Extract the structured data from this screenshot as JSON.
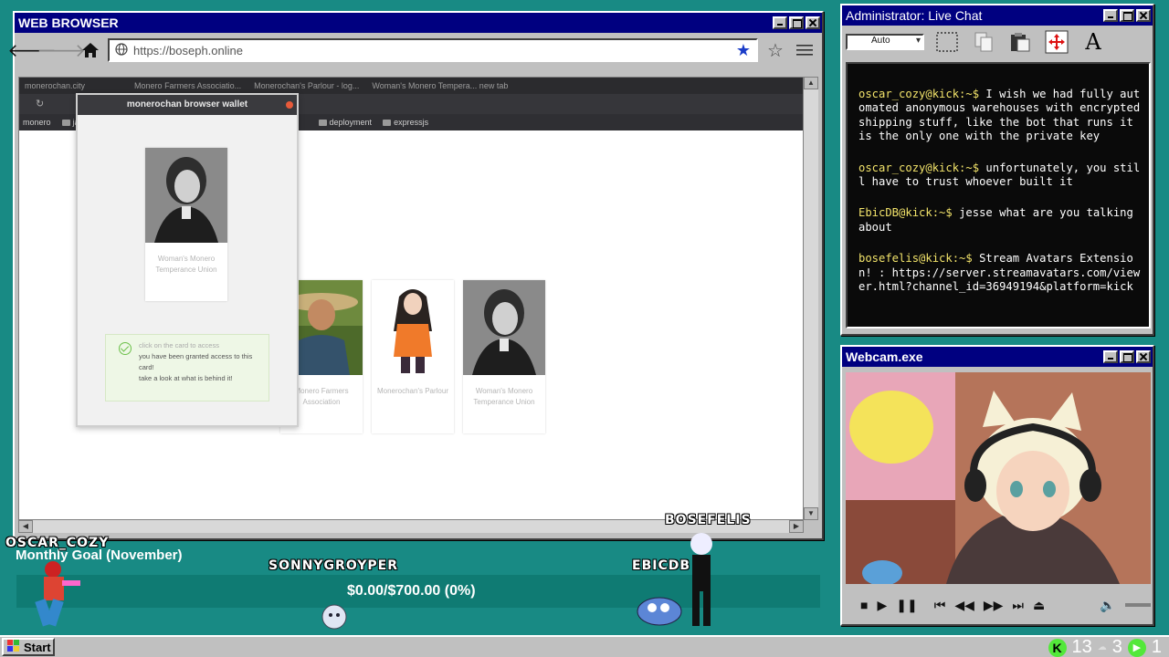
{
  "browser": {
    "title": "WEB BROWSER",
    "url": "https://boseph.online",
    "inner_tabs": [
      "monerochan.city",
      "Monero Farmers Associatio...",
      "Monerochan's Parlour - log...",
      "Woman's Monero Tempera... new tab"
    ],
    "bookmarks": [
      "monero",
      "ja",
      "deployment",
      "expressjs"
    ],
    "wallet": {
      "header": "monerochan browser wallet",
      "card_caption": "Woman's Monero Temperance Union",
      "notice_line1": "click on the card to access",
      "notice_line2": "you have been granted access to this card!",
      "notice_line3": "take a look at what is behind it!"
    },
    "cards": [
      {
        "caption": "Monero Farmers Association"
      },
      {
        "caption": "Monerochan's Parlour"
      },
      {
        "caption": "Woman's Monero Temperance Union"
      }
    ]
  },
  "chat": {
    "title": "Administrator: Live Chat",
    "font_size": "Auto",
    "messages": [
      {
        "user": "oscar_cozy@kick:~$",
        "text": "I wish we had fully automated anonymous warehouses with encrypted shipping stuff, like the bot that runs it is the only one with the private key"
      },
      {
        "user": "oscar_cozy@kick:~$",
        "text": "unfortunately, you still have to trust whoever built it"
      },
      {
        "user": "EbicDB@kick:~$",
        "text": "jesse what are you talking about"
      },
      {
        "user": "bosefelis@kick:~$",
        "text": "Stream Avatars Extension! : https://server.streamavatars.com/viewer.html?channel_id=36949194&platform=kick"
      }
    ]
  },
  "webcam": {
    "title": "Webcam.exe"
  },
  "overlay": {
    "goal_title": "Monthly Goal (November)",
    "goal_text": "$0.00/$700.00 (0%)",
    "avatars": [
      "OSCAR_COZY",
      "SONNYGROYPER",
      "EBICDB",
      "BOSEFELIS"
    ]
  },
  "taskbar": {
    "start": "Start",
    "tray_1": "13",
    "tray_2": "3",
    "tray_3": "1"
  },
  "colors": {
    "desktop": "#188a84",
    "titlebar": "#000080",
    "chat_user": "#f2e36a",
    "goal_bar": "#0f7b73"
  }
}
